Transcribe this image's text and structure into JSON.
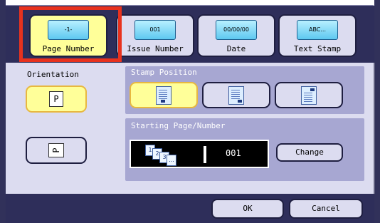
{
  "tabs": [
    {
      "label": "Page Number",
      "chip": "-1-",
      "selected": true
    },
    {
      "label": "Issue Number",
      "chip": "001",
      "selected": false
    },
    {
      "label": "Date",
      "chip": "00/00/00",
      "selected": false
    },
    {
      "label": "Text Stamp",
      "chip": "ABC...",
      "selected": false
    }
  ],
  "orientation": {
    "label": "Orientation",
    "portrait_glyph": "P",
    "landscape_glyph": "P",
    "selected": "portrait"
  },
  "stamp_position": {
    "title": "Stamp Position",
    "options": [
      "bottom-center",
      "bottom-right",
      "top-right"
    ],
    "selected": "bottom-center"
  },
  "starting": {
    "title": "Starting Page/Number",
    "icon_digits": [
      "1",
      "2",
      "3",
      "..."
    ],
    "value": "001",
    "change_label": "Change"
  },
  "footer": {
    "ok_label": "OK",
    "cancel_label": "Cancel"
  },
  "colors": {
    "selected_fill": "#ffff99",
    "highlight": "#e8321e",
    "frame_dark": "#2e2e5a"
  }
}
